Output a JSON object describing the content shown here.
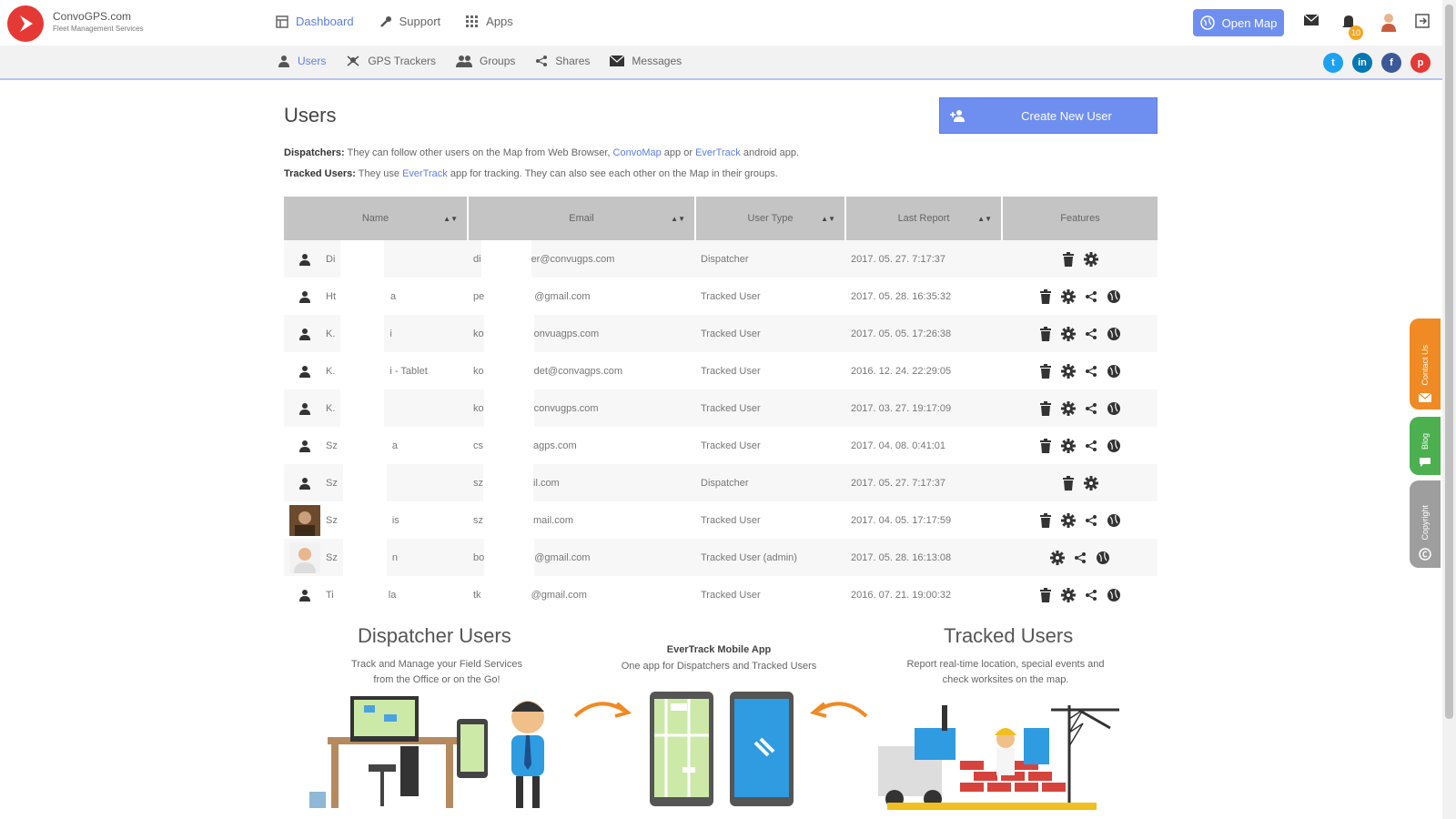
{
  "header": {
    "brand_title": "ConvoGPS.com",
    "brand_subtitle": "Fleet Management Services",
    "nav": [
      {
        "label": "Dashboard",
        "icon": "dashboard-icon"
      },
      {
        "label": "Support",
        "icon": "wrench-icon"
      },
      {
        "label": "Apps",
        "icon": "apps-grid-icon"
      }
    ],
    "open_map_label": "Open Map",
    "notification_count": "10"
  },
  "subnav": [
    {
      "label": "Users",
      "icon": "user-icon"
    },
    {
      "label": "GPS Trackers",
      "icon": "tracker-icon"
    },
    {
      "label": "Groups",
      "icon": "group-icon"
    },
    {
      "label": "Shares",
      "icon": "share-icon"
    },
    {
      "label": "Messages",
      "icon": "envelope-icon"
    }
  ],
  "social": [
    {
      "name": "twitter-icon",
      "glyph": "t",
      "color": "#1da1f2"
    },
    {
      "name": "linkedin-icon",
      "glyph": "in",
      "color": "#0077b5"
    },
    {
      "name": "facebook-icon",
      "glyph": "f",
      "color": "#3b5998"
    },
    {
      "name": "pinterest-icon",
      "glyph": "p",
      "color": "#e53935"
    }
  ],
  "page": {
    "title": "Users",
    "create_button": "Create New User",
    "desc1": {
      "bold": "Dispatchers:",
      "t1": " They can follow other users on the Map from Web Browser, ",
      "l1": "ConvoMap",
      "t2": " app or ",
      "l2": "EverTrack",
      "t3": " android app."
    },
    "desc2": {
      "bold": "Tracked Users:",
      "t1": " They use ",
      "l1": "EverTrack",
      "t2": " app for tracking. They can also see each other on the Map in their groups."
    }
  },
  "table": {
    "columns": [
      "Name",
      "Email",
      "User Type",
      "Last Report",
      "Features"
    ],
    "rows": [
      {
        "name_a": "Di",
        "name_b": "",
        "email_a": "di",
        "email_b": "er@convugps.com",
        "type": "Dispatcher",
        "last": "2017. 05. 27. 7:17:37",
        "features": [
          "trash",
          "gear"
        ],
        "avatar": "person"
      },
      {
        "name_a": "Ht",
        "name_b": "a",
        "email_a": "pe",
        "email_b": "@gmail.com",
        "type": "Tracked User",
        "last": "2017. 05. 28. 16:35:32",
        "features": [
          "trash",
          "gear",
          "share",
          "globe"
        ],
        "avatar": "person"
      },
      {
        "name_a": "K.",
        "name_b": "i",
        "email_a": "ko",
        "email_b": "onvuagps.com",
        "type": "Tracked User",
        "last": "2017. 05. 05. 17:26:38",
        "features": [
          "trash",
          "gear",
          "share",
          "globe"
        ],
        "avatar": "person"
      },
      {
        "name_a": "K.",
        "name_b": "i - Tablet",
        "email_a": "ko",
        "email_b": "det@convagps.com",
        "type": "Tracked User",
        "last": "2016. 12. 24. 22:29:05",
        "features": [
          "trash",
          "gear",
          "share",
          "globe"
        ],
        "avatar": "person"
      },
      {
        "name_a": "K.",
        "name_b": "",
        "email_a": "ko",
        "email_b": "convugps.com",
        "type": "Tracked User",
        "last": "2017. 03. 27. 19:17:09",
        "features": [
          "trash",
          "gear",
          "share",
          "globe"
        ],
        "avatar": "person"
      },
      {
        "name_a": "Sz",
        "name_b": "a",
        "email_a": "cs",
        "email_b": "agps.com",
        "type": "Tracked User",
        "last": "2017. 04. 08. 0:41:01",
        "features": [
          "trash",
          "gear",
          "share",
          "globe"
        ],
        "avatar": "person"
      },
      {
        "name_a": "Sz",
        "name_b": "",
        "email_a": "sz",
        "email_b": "il.com",
        "type": "Dispatcher",
        "last": "2017. 05. 27. 7:17:37",
        "features": [
          "trash",
          "gear"
        ],
        "avatar": "person"
      },
      {
        "name_a": "Sz",
        "name_b": "is",
        "email_a": "sz",
        "email_b": "mail.com",
        "type": "Tracked User",
        "last": "2017. 04. 05. 17:17:59",
        "features": [
          "trash",
          "gear",
          "share",
          "globe"
        ],
        "avatar": "photo-dark"
      },
      {
        "name_a": "Sz",
        "name_b": "n",
        "email_a": "bo",
        "email_b": "@gmail.com",
        "type": "Tracked User (admin)",
        "last": "2017. 05. 28. 16:13:08",
        "features": [
          "gear",
          "share",
          "globe"
        ],
        "avatar": "photo-light"
      },
      {
        "name_a": "Ti",
        "name_b": "la",
        "email_a": "tk",
        "email_b": "@gmail.com",
        "type": "Tracked User",
        "last": "2016. 07. 21. 19:00:32",
        "features": [
          "trash",
          "gear",
          "share",
          "globe"
        ],
        "avatar": "person"
      }
    ]
  },
  "side_tabs": [
    {
      "label": "Contact Us",
      "color": "#f08a24",
      "icon": "mail-icon"
    },
    {
      "label": "Blog",
      "color": "#4caf50",
      "icon": "chat-icon"
    },
    {
      "label": "Copyright",
      "color": "#9e9e9e",
      "icon": "copyright-icon"
    }
  ],
  "promo": {
    "dispatcher_title": "Dispatcher Users",
    "dispatcher_sub1": "Track and Manage your Field Services",
    "dispatcher_sub2": "from the Office or on the Go!",
    "app_title": "EverTrack Mobile App",
    "app_sub": "One app for Dispatchers and Tracked Users",
    "tracked_title": "Tracked Users",
    "tracked_sub1": "Report real-time location, special events and",
    "tracked_sub2": "check worksites on the map."
  }
}
